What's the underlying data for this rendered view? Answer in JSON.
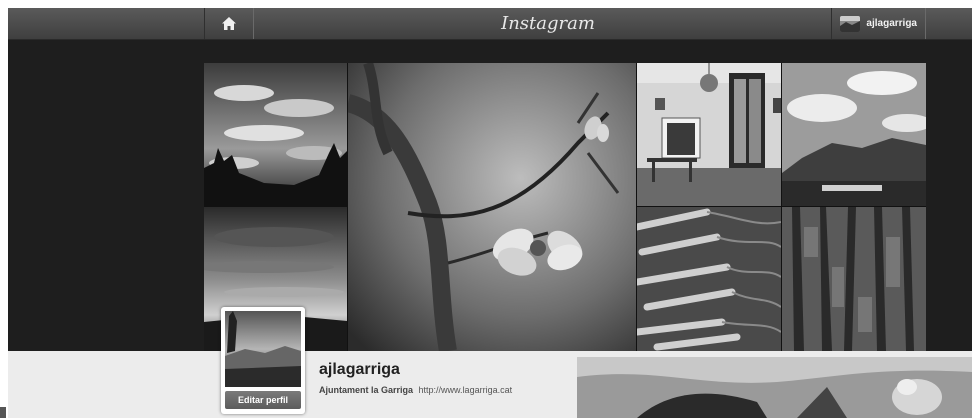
{
  "header": {
    "home_icon": "home-icon",
    "brand": "Instagram",
    "username": "ajlagarriga"
  },
  "profile": {
    "username": "ajlagarriga",
    "full_name": "Ajuntament la Garriga",
    "website": "http://www.lagarriga.cat",
    "edit_button": "Editar perfil"
  },
  "photos": [
    {
      "subject": "cloudy-sky-trees"
    },
    {
      "subject": "almond-blossom-branch"
    },
    {
      "subject": "interior-room-door"
    },
    {
      "subject": "mountain-village-landscape"
    },
    {
      "subject": "sunset-clouds"
    },
    {
      "subject": "spring-onions"
    },
    {
      "subject": "tree-bark"
    }
  ],
  "colors": {
    "topbar": "#4a4a4a",
    "background": "#1e1e1e",
    "lower_band": "#ececec"
  }
}
